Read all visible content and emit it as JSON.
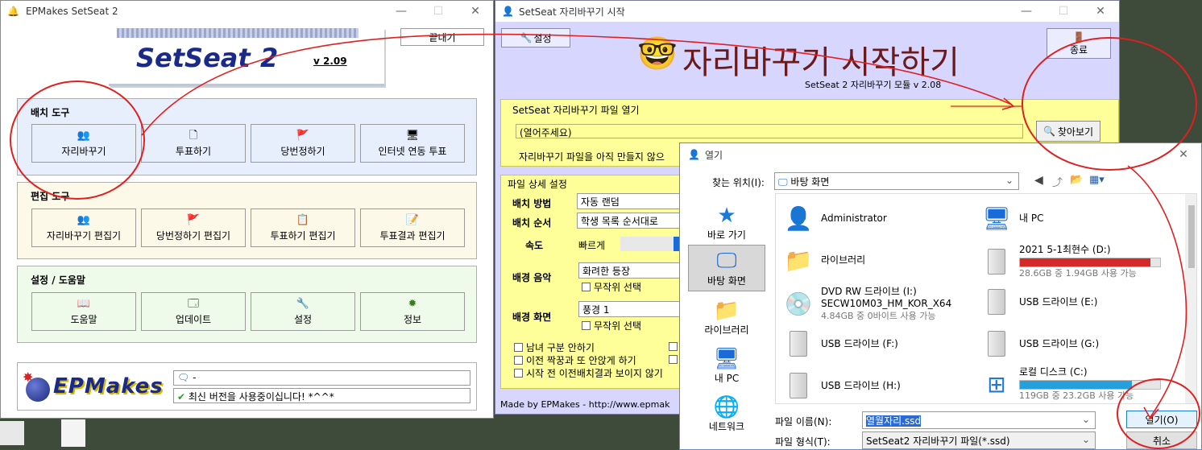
{
  "w1": {
    "title": "EPMakes SetSeat 2",
    "logo": "SetSeat",
    "logo_num": "2",
    "version": "v 2.09",
    "quit": "끝내기",
    "groups": [
      {
        "title": "배치 도구",
        "buttons": [
          {
            "label": "자리바꾸기",
            "icon": "👥"
          },
          {
            "label": "투표하기",
            "icon": "🗋"
          },
          {
            "label": "당번정하기",
            "icon": "🚩"
          },
          {
            "label": "인터넷 연동 투표",
            "icon": "🖥"
          }
        ]
      },
      {
        "title": "편집 도구",
        "buttons": [
          {
            "label": "자리바꾸기 편집기",
            "icon": "👥"
          },
          {
            "label": "당번정하기 편집기",
            "icon": "🚩"
          },
          {
            "label": "투표하기 편집기",
            "icon": "📋"
          },
          {
            "label": "투표결과 편집기",
            "icon": "📝"
          }
        ]
      },
      {
        "title": "설정 / 도움말",
        "buttons": [
          {
            "label": "도움말",
            "icon": "📖"
          },
          {
            "label": "업데이트",
            "icon": "🗔"
          },
          {
            "label": "설정",
            "icon": "🔧"
          },
          {
            "label": "정보",
            "icon": "✹"
          }
        ]
      }
    ],
    "brand": "EPMakes",
    "msg1": "-",
    "msg2": "최신 버전을 사용중이십니다! *^^*"
  },
  "w2": {
    "title": "SetSeat 자리바꾸기 시작",
    "settings_btn": "설정",
    "heading": "자리바꾸기 시작하기",
    "subtitle": "SetSeat 2 자리바꾸기 모듈 v 2.08",
    "close_btn": "종료",
    "file_section": "SetSeat 자리바꾸기 파일 열기",
    "file_value": "(열어주세요)",
    "browse": "찾아보기",
    "file_note": "자리바꾸기 파일을 아직 만들지 않으",
    "detail_section": "파일 상세 설정",
    "method_label": "배치 방법",
    "method_value": "자동 랜덤",
    "order_label": "배치 순서",
    "order_value": "학생 목록 순서대로",
    "speed_label": "속도",
    "speed_value": "빠르게",
    "music_label": "배경 음악",
    "music_value": "화려한 등장",
    "music_random": "무작위 선택",
    "screen_label": "배경 화면",
    "screen_value": "풍경 1",
    "screen_random": "무작위 선택",
    "opt1": "남녀 구분 안하기",
    "opt2": "이전 짝꿍과 또 안앉게 하기",
    "opt3": "시작 전 이전배치결과 보이지 않기",
    "footer": "Made by EPMakes - http://www.epmak"
  },
  "w3": {
    "title": "열기",
    "location_label": "찾는 위치(I):",
    "location_value": "바탕 화면",
    "nav": [
      {
        "label": "바로 가기",
        "icon": "★"
      },
      {
        "label": "바탕 화면",
        "icon": "🖵"
      },
      {
        "label": "라이브러리",
        "icon": "📁"
      },
      {
        "label": "내 PC",
        "icon": "🖥"
      },
      {
        "label": "네트워크",
        "icon": "🌐"
      }
    ],
    "items": [
      {
        "name": "Administrator",
        "sub": "",
        "icon": "user-folder-icon"
      },
      {
        "name": "내 PC",
        "sub": "",
        "icon": "pc-icon"
      },
      {
        "name": "라이브러리",
        "sub": "",
        "icon": "library-icon"
      },
      {
        "name": "2021 5-1최현수 (D:)",
        "sub": "28.6GB 중 1.94GB 사용 가능",
        "used": 0.93,
        "bar": "#d42a2a",
        "icon": "drive-icon"
      },
      {
        "name": "DVD RW 드라이브 (I:)",
        "name2": "SECW10M03_HM_KOR_X64",
        "sub": "4.84GB 중 0바이트 사용 가능",
        "icon": "dvd-icon"
      },
      {
        "name": "USB 드라이브 (E:)",
        "sub": "",
        "icon": "drive-icon"
      },
      {
        "name": "USB 드라이브 (F:)",
        "sub": "",
        "icon": "drive-icon"
      },
      {
        "name": "USB 드라이브 (G:)",
        "sub": "",
        "icon": "drive-icon"
      },
      {
        "name": "USB 드라이브 (H:)",
        "sub": "",
        "icon": "drive-icon"
      },
      {
        "name": "로컬 디스크 (C:)",
        "sub": "119GB 중 23.2GB 사용 가능",
        "used": 0.8,
        "bar": "#26a0da",
        "icon": "windows-drive-icon"
      }
    ],
    "filename_label": "파일 이름(N):",
    "filename_value": "열월자리.ssd",
    "filetype_label": "파일 형식(T):",
    "filetype_value": "SetSeat2 자리바꾸기 파일(*.ssd)",
    "open_btn": "열기(O)",
    "cancel_btn": "취소"
  }
}
